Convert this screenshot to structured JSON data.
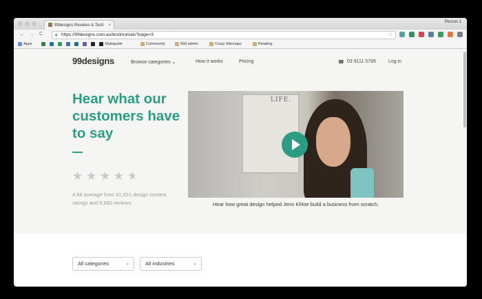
{
  "browser": {
    "tab_title": "99designs Reviews & Testi",
    "tab_close": "×",
    "profile": "Person 1",
    "nav_back": "←",
    "nav_forward": "→",
    "nav_reload": "C",
    "url": "https://99designs.com.au/testimonials?page=3",
    "star": "☆",
    "bookmarks": {
      "apps": "Apps",
      "styleguide": "Styleguide",
      "community": "Community",
      "admin": "99d admin",
      "sitemaps": "Crazy Sitemaps",
      "reading": "Reading"
    }
  },
  "site": {
    "logo": "99designs",
    "nav": {
      "browse": "Browse categories",
      "browse_chevron": "⌄",
      "how": "How it works",
      "pricing": "Pricing",
      "phone_icon": "☎",
      "phone": "03 9111 5799",
      "login": "Log in"
    },
    "hero": {
      "headline": "Hear what our customers have to say",
      "stars": "★",
      "rating_value": 4.68,
      "rating_text": "4.68 average from 31,021 design contest ratings and 5,660 reviews",
      "video_board_text": "LIFE.",
      "caption": "Hear how great design helped Jenn Khloe build a business from scratch."
    },
    "filters": {
      "categories": "All categories",
      "industries": "All industries",
      "chevron": "⌄"
    }
  },
  "colors": {
    "brand": "#2c9c83"
  }
}
